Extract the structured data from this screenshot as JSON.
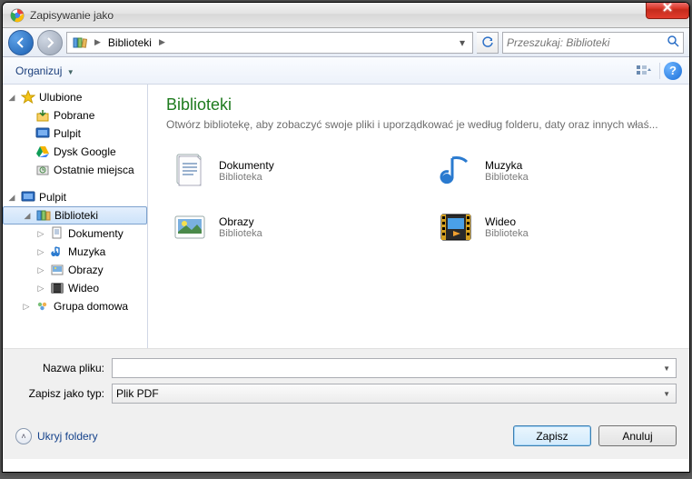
{
  "window": {
    "title": "Zapisywanie jako"
  },
  "breadcrumb": {
    "segments": [
      "Biblioteki"
    ]
  },
  "search": {
    "placeholder": "Przeszukaj: Biblioteki"
  },
  "toolbar": {
    "organize": "Organizuj"
  },
  "tree": {
    "groups": [
      {
        "label": "Ulubione",
        "icon": "star",
        "children": [
          {
            "label": "Pobrane",
            "icon": "download"
          },
          {
            "label": "Pulpit",
            "icon": "desktop"
          },
          {
            "label": "Dysk Google",
            "icon": "gdrive"
          },
          {
            "label": "Ostatnie miejsca",
            "icon": "recent"
          }
        ]
      },
      {
        "label": "Pulpit",
        "icon": "desktop",
        "children": [
          {
            "label": "Biblioteki",
            "icon": "libraries",
            "selected": true,
            "children": [
              {
                "label": "Dokumenty",
                "icon": "doc"
              },
              {
                "label": "Muzyka",
                "icon": "music"
              },
              {
                "label": "Obrazy",
                "icon": "pic"
              },
              {
                "label": "Wideo",
                "icon": "vid"
              }
            ]
          },
          {
            "label": "Grupa domowa",
            "icon": "homegroup"
          }
        ]
      }
    ]
  },
  "content": {
    "heading": "Biblioteki",
    "sub": "Otwórz bibliotekę, aby zobaczyć swoje pliki i uporządkować je według folderu, daty oraz innych właś...",
    "type_label": "Biblioteka",
    "items": [
      {
        "name": "Dokumenty",
        "icon": "doc"
      },
      {
        "name": "Muzyka",
        "icon": "music"
      },
      {
        "name": "Obrazy",
        "icon": "pic"
      },
      {
        "name": "Wideo",
        "icon": "vid"
      }
    ]
  },
  "form": {
    "filename_label": "Nazwa pliku:",
    "filename_value": "",
    "filetype_label": "Zapisz jako typ:",
    "filetype_value": "Plik PDF"
  },
  "footer": {
    "hide_folders": "Ukryj foldery",
    "save": "Zapisz",
    "cancel": "Anuluj"
  }
}
